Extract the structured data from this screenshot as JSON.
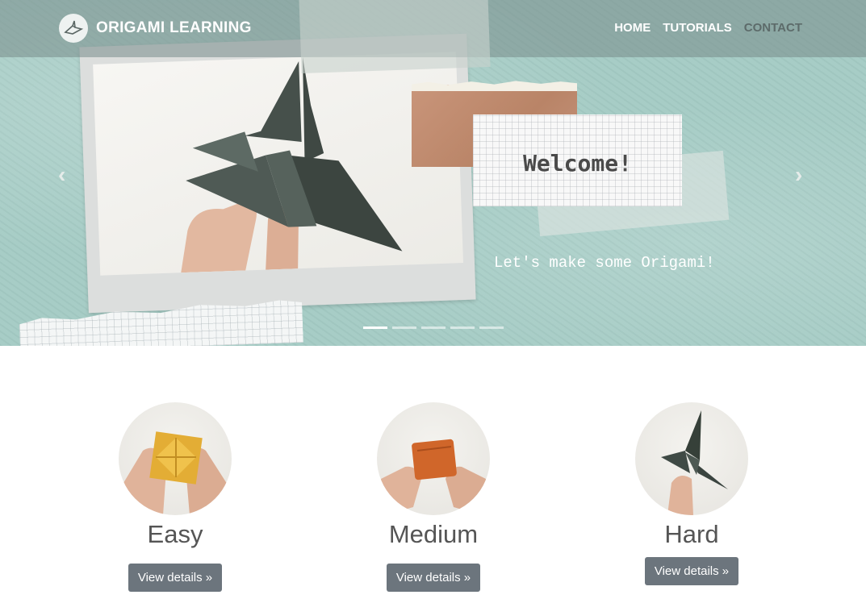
{
  "brand": {
    "name": "ORIGAMI LEARNING",
    "logo_icon": "origami-crane-logo"
  },
  "nav": {
    "items": [
      {
        "label": "HOME",
        "active": true
      },
      {
        "label": "TUTORIALS",
        "active": true
      },
      {
        "label": "CONTACT",
        "active": false
      }
    ]
  },
  "hero": {
    "heading": "Welcome!",
    "tagline": "Let's make some Origami!",
    "prev_icon": "chevron-left-icon",
    "next_icon": "chevron-right-icon",
    "slide_count": 5,
    "active_slide": 1
  },
  "levels": [
    {
      "title": "Easy",
      "button": "View details »",
      "image": "yellow-origami-cube"
    },
    {
      "title": "Medium",
      "button": "View details »",
      "image": "orange-origami-cube"
    },
    {
      "title": "Hard",
      "button": "View details »",
      "image": "green-origami-crane"
    }
  ],
  "colors": {
    "hero_bg": "#a4cbc4",
    "navbar_bg": "#788c8a",
    "button_bg": "#6c757d",
    "kraft_paper": "#b98467"
  }
}
